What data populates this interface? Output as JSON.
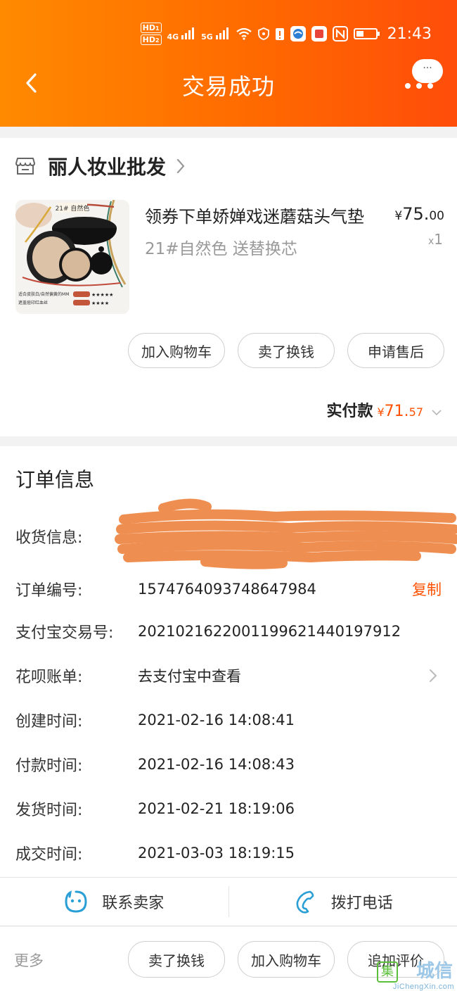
{
  "status_bar": {
    "hd1": "HD",
    "hd1_sub": "1",
    "hd2": "HD",
    "hd2_sub": "2",
    "net1": "4G",
    "net2": "5G",
    "time": "21:43"
  },
  "header": {
    "title": "交易成功",
    "more_bubble": "···"
  },
  "shop": {
    "name": "丽人妆业批发"
  },
  "product": {
    "title": "领券下单娇婵戏迷蘑菇头气垫",
    "spec": "21#自然色 送替换芯",
    "price_currency": "¥",
    "price_int": "75.",
    "price_dec": "00",
    "qty_prefix": "x",
    "qty": "1",
    "image_badge": "21# 自然色",
    "image_caption_1": "适合皮肤白/自然偏黄的MM",
    "image_caption_2": "遮盖痘印红血丝"
  },
  "actions": {
    "add_cart": "加入购物车",
    "resell": "卖了换钱",
    "after_sale": "申请售后"
  },
  "payment": {
    "label": "实付款",
    "currency": "¥",
    "int": "71.",
    "dec": "57"
  },
  "order_info": {
    "title": "订单信息",
    "rows": [
      {
        "label": "收货信息:",
        "value": ""
      },
      {
        "label": "订单编号:",
        "value": "1574764093748647984"
      },
      {
        "label": "支付宝交易号:",
        "value": "2021021622001199621440197912"
      },
      {
        "label": "花呗账单:",
        "value": "去支付宝中查看"
      },
      {
        "label": "创建时间:",
        "value": "2021-02-16 14:08:41"
      },
      {
        "label": "付款时间:",
        "value": "2021-02-16 14:08:43"
      },
      {
        "label": "发货时间:",
        "value": "2021-02-21 18:19:06"
      },
      {
        "label": "成交时间:",
        "value": "2021-03-03 18:19:15"
      }
    ],
    "copy_label": "复制"
  },
  "contact": {
    "seller": "联系卖家",
    "phone": "拨打电话"
  },
  "bottom": {
    "more": "更多",
    "resell": "卖了换钱",
    "add_cart": "加入购物车",
    "review": "追加评价"
  },
  "watermark": {
    "text": "JiChengXin.com",
    "big": "城信",
    "logo": "集"
  },
  "colors": {
    "header_start": "#ff8a00",
    "header_end": "#ff4d0a",
    "accent": "#ff5000",
    "contact_icon": "#2a9fd6"
  }
}
